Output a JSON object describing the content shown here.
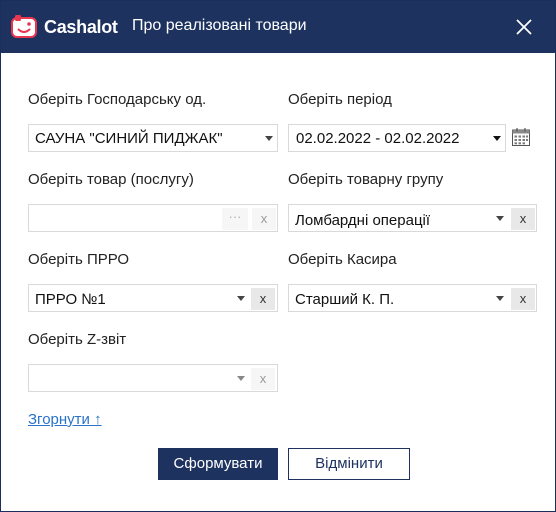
{
  "app": {
    "brand": "Cashalot",
    "dialog_title": "Про реалізовані товари"
  },
  "form": {
    "business_unit": {
      "label": "Оберіть Господарську од.",
      "value": "САУНА \"СИНИЙ ПИДЖАК\""
    },
    "period": {
      "label": "Оберіть період",
      "value": "02.02.2022 - 02.02.2022"
    },
    "product": {
      "label": "Оберіть товар (послугу)",
      "value": "",
      "dots": "···",
      "clear": "x"
    },
    "product_group": {
      "label": "Оберіть товарну групу",
      "value": "Ломбардні операції",
      "clear": "x"
    },
    "prro": {
      "label": "Оберіть ПРРО",
      "value": "ПРРО №1",
      "clear": "x"
    },
    "cashier": {
      "label": "Оберіть Касира",
      "value": "Старший К. П.",
      "clear": "x"
    },
    "z_report": {
      "label": "Оберіть Z-звіт",
      "value": "",
      "clear": "x"
    }
  },
  "collapse_link": "Згорнути ↑",
  "buttons": {
    "submit": "Сформувати",
    "cancel": "Відмінити"
  },
  "colors": {
    "header": "#1e3260",
    "accent": "#e8374f",
    "link": "#2a73c9"
  }
}
